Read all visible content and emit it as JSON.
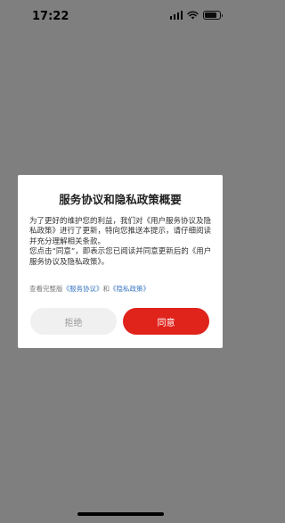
{
  "status_bar": {
    "time": "17:22",
    "icons": [
      "cellular-signal-icon",
      "wifi-icon",
      "battery-icon"
    ]
  },
  "dialog": {
    "title": "服务协议和隐私政策概要",
    "body_paragraph_1": "为了更好的维护您的利益，我们对《用户服务协议及隐私政策》进行了更新，特向您推送本提示，请仔细阅读并充分理解相关条款。",
    "body_paragraph_2": "您点击“同意”，即表示您已阅读并同意更新后的《用户服务协议及隐私政策》。",
    "links": {
      "prefix": "查看完整版",
      "service_agreement": "《服务协议》",
      "connector": "和",
      "privacy_policy": "《隐私政策》"
    },
    "reject_label": "拒绝",
    "agree_label": "同意"
  },
  "colors": {
    "overlay": "#7f7f7f",
    "agree_button": "#e0231b",
    "reject_button": "#f0f0f0",
    "link": "#3a78c2"
  }
}
